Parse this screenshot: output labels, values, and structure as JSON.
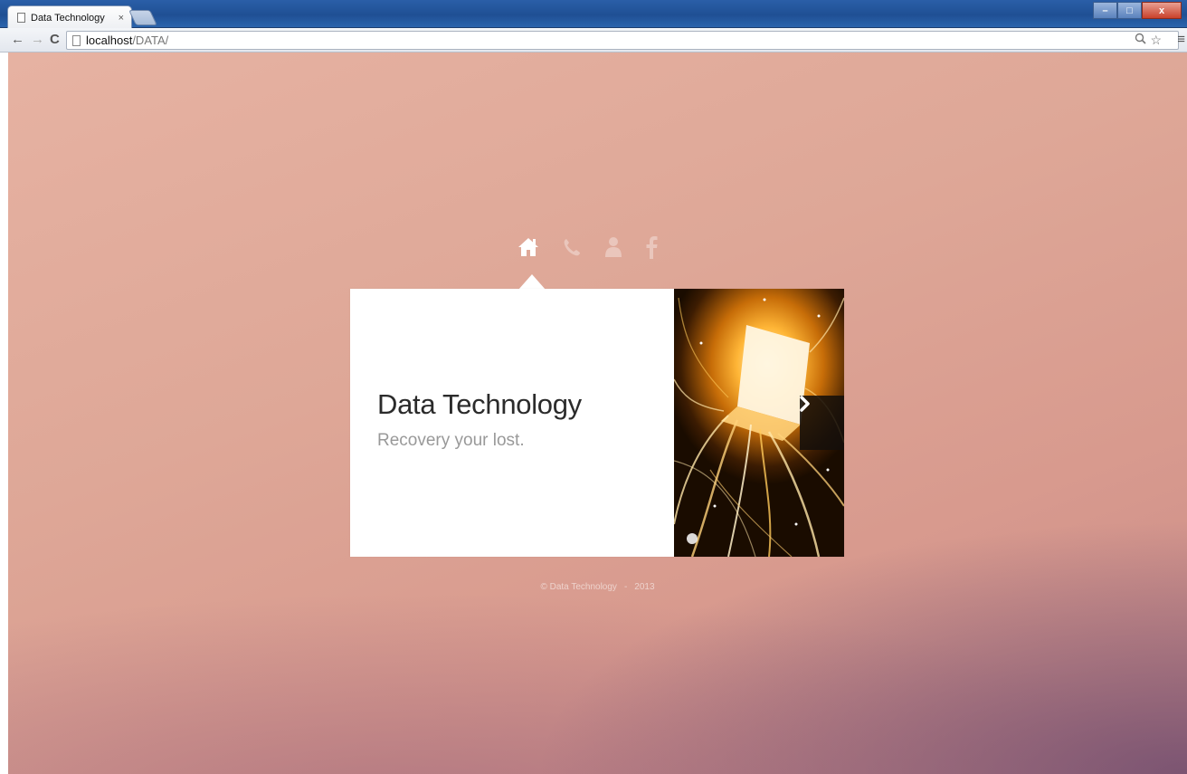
{
  "browser": {
    "tab_title": "Data Technology",
    "tab_close_glyph": "×",
    "url_host": "localhost",
    "url_path": "/DATA/",
    "controls": {
      "minimize": "–",
      "maximize": "□",
      "close": "x"
    }
  },
  "nav": {
    "icons": [
      "home-icon",
      "phone-icon",
      "user-icon",
      "facebook-icon"
    ],
    "active": "home-icon"
  },
  "card": {
    "title": "Data Technology",
    "subtitle": "Recovery your lost."
  },
  "footer": {
    "copyright": "© Data Technology",
    "separator": "-",
    "year": "2013"
  },
  "colors": {
    "card_background": "#ffffff",
    "title": "#2b2b2b",
    "subtitle": "#999999",
    "accent_orange": "#ffb637"
  }
}
